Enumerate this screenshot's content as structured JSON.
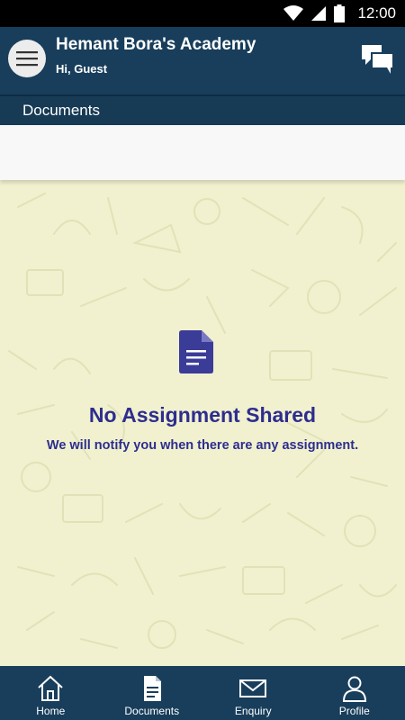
{
  "status_bar": {
    "time": "12:00"
  },
  "header": {
    "title": "Hemant Bora's Academy",
    "subtitle": "Hi, Guest"
  },
  "page": {
    "title": "Documents"
  },
  "empty_state": {
    "title": "No Assignment Shared",
    "message": "We will notify you when there are any assignment."
  },
  "bottom_nav": {
    "items": [
      {
        "label": "Home",
        "icon": "home-icon"
      },
      {
        "label": "Documents",
        "icon": "document-icon"
      },
      {
        "label": "Enquiry",
        "icon": "mail-icon"
      },
      {
        "label": "Profile",
        "icon": "profile-icon"
      }
    ]
  },
  "colors": {
    "header_bg": "#183e5b",
    "accent_text": "#2d2d8f",
    "content_bg": "#f1f1cf"
  }
}
